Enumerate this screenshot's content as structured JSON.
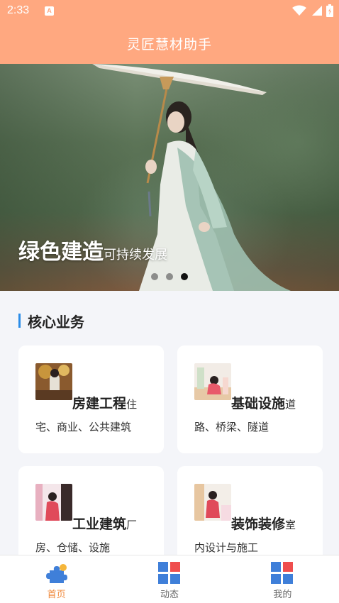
{
  "status_bar": {
    "time": "2:33",
    "notification_icon": "a-notification-icon",
    "wifi_icon": "wifi-icon",
    "signal_icon": "signal-icon",
    "battery_icon": "battery-icon"
  },
  "app_bar": {
    "title": "灵匠慧材助手"
  },
  "banner": {
    "headline_big": "绿色建造",
    "headline_small": "可持续发展",
    "slide_count": 3,
    "active_slide": 3
  },
  "section": {
    "title": "核心业务"
  },
  "cards": [
    {
      "name": "房建工程",
      "desc_line1": "住",
      "desc_line2": "宅、商业、公共建筑"
    },
    {
      "name": "基础设施",
      "desc_line1": "道",
      "desc_line2": "路、桥梁、隧道"
    },
    {
      "name": "工业建筑",
      "desc_line1": "厂",
      "desc_line2": "房、仓储、设施"
    },
    {
      "name": "装饰装修",
      "desc_line1": "室",
      "desc_line2": "内设计与施工"
    }
  ],
  "tabs": [
    {
      "label": "首页",
      "icon": "home-puzzle-icon",
      "active": true
    },
    {
      "label": "动态",
      "icon": "grid-icon",
      "active": false
    },
    {
      "label": "我的",
      "icon": "grid-icon",
      "active": false
    }
  ],
  "colors": {
    "primary": "#ffa880",
    "tab_active": "#f08a3c",
    "section_accent": "#2a8ce8",
    "grid_blue": "#3f7fd9",
    "grid_red": "#ef4e4e"
  }
}
